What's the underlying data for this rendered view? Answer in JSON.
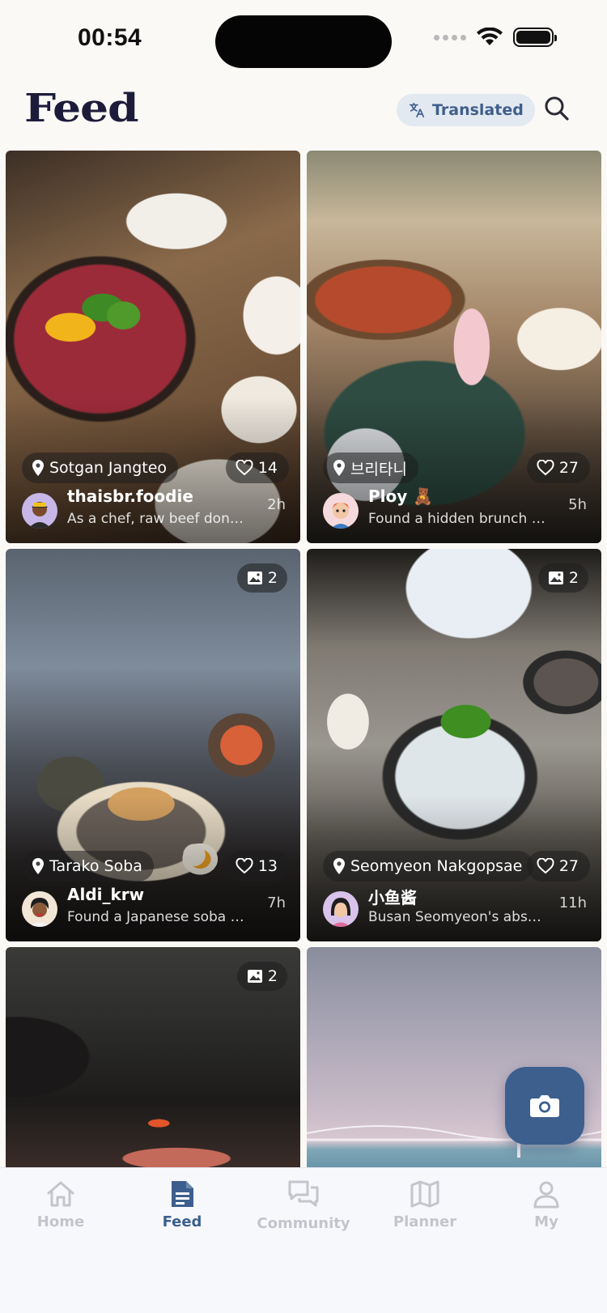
{
  "status": {
    "time": "00:54"
  },
  "header": {
    "title": "Feed",
    "translated_label": "Translated"
  },
  "cards": [
    {
      "location": "Sotgan Jangteo",
      "likes": "14",
      "user": "thaisbr.foodie",
      "caption": "As a chef, raw beef done ri...",
      "ago": "2h"
    },
    {
      "location": "브리타니",
      "likes": "27",
      "user": "Ploy 🧸",
      "caption": "Found a hidden brunch sp...",
      "ago": "5h"
    },
    {
      "image_count": "2",
      "location": "Tarako Soba",
      "likes": "13",
      "user": "Aldi_krw",
      "caption": "Found a Japanese soba sp...",
      "ago": "7h"
    },
    {
      "image_count": "2",
      "location": "Seomyeon Nakgopsae",
      "likes": "27",
      "user": "小鱼酱",
      "caption": "Busan Seomyeon's absol...",
      "ago": "11h"
    },
    {
      "image_count": "2"
    },
    {}
  ],
  "tabs": [
    {
      "label": "Home",
      "icon": "home-icon"
    },
    {
      "label": "Feed",
      "icon": "feed-icon",
      "active": true
    },
    {
      "label": "Community",
      "icon": "community-icon"
    },
    {
      "label": "Planner",
      "icon": "map-icon"
    },
    {
      "label": "My",
      "icon": "person-icon"
    }
  ],
  "colors": {
    "accent": "#3c5f8e",
    "background": "#fbf9f6",
    "inactive_tab": "#c3c5cc"
  }
}
